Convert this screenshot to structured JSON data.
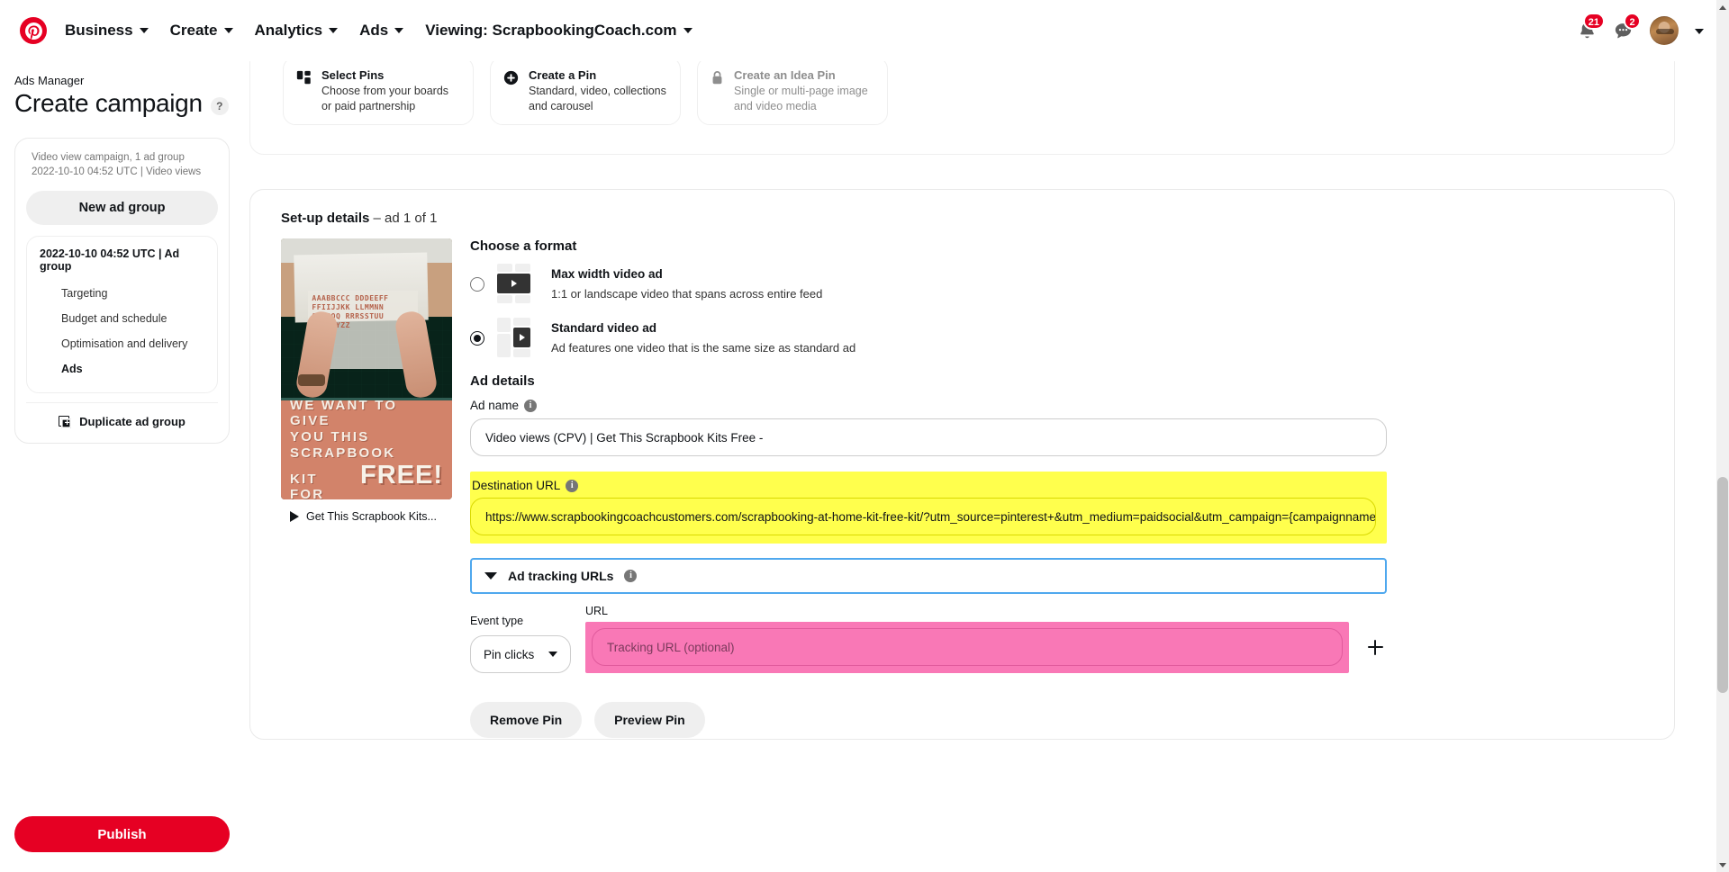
{
  "topnav": {
    "logo_icon": "pinterest-logo-icon",
    "items": [
      {
        "label": "Business",
        "icon": "chevron-down-icon"
      },
      {
        "label": "Create",
        "icon": "chevron-down-icon"
      },
      {
        "label": "Analytics",
        "icon": "chevron-down-icon"
      },
      {
        "label": "Ads",
        "icon": "chevron-down-icon"
      },
      {
        "label": "Viewing: ScrapbookingCoach.com",
        "icon": "chevron-down-icon"
      }
    ],
    "notifications_badge": "21",
    "messages_badge": "2",
    "notifications_icon": "bell-icon",
    "messages_icon": "chat-bubble-icon",
    "avatar_icon": "user-avatar",
    "account_chevron_icon": "chevron-down-icon"
  },
  "sidebar": {
    "eyebrow": "Ads Manager",
    "title": "Create campaign",
    "help_label": "?",
    "campaign_meta_line1": "Video view campaign, 1 ad group",
    "campaign_meta_line2": "2022-10-10 04:52 UTC | Video views",
    "new_ad_group_label": "New ad group",
    "ad_group_title": "2022-10-10 04:52 UTC | Ad group",
    "nav_items": [
      {
        "label": "Targeting",
        "active": false
      },
      {
        "label": "Budget and schedule",
        "active": false
      },
      {
        "label": "Optimisation and delivery",
        "active": false
      },
      {
        "label": "Ads",
        "active": true
      }
    ],
    "duplicate_label": "Duplicate ad group",
    "duplicate_icon": "duplicate-icon",
    "publish_label": "Publish",
    "publish_color": "#e60023"
  },
  "pin_source_cards": [
    {
      "title": "Select Pins",
      "desc_line1": "Choose from your boards",
      "desc_line2": "or paid partnership",
      "icon": "grid-pins-icon",
      "disabled": false
    },
    {
      "title": "Create a Pin",
      "desc_line1": "Standard, video, collections",
      "desc_line2": "and carousel",
      "icon": "plus-circle-icon",
      "disabled": false
    },
    {
      "title": "Create an Idea Pin",
      "desc_line1": "Single or multi-page image",
      "desc_line2": "and video media",
      "icon": "lock-icon",
      "disabled": true
    }
  ],
  "setup": {
    "heading_bold": "Set-up details",
    "heading_muted": " – ad 1 of 1",
    "preview": {
      "overlay_line1": "WE WANT TO GIVE",
      "overlay_line2": "YOU THIS SCRAPBOOK",
      "overlay_line3_kit": "KIT FOR",
      "overlay_line3_free": "FREE!",
      "sheet_text": "AAABBCCC DDDEEFF FFIIJJKK LLMMNN OOPPQQ RRRSSTUU VVWXYYZZ",
      "caption": "Get This Scrapbook Kits...",
      "play_icon": "play-icon"
    },
    "format": {
      "section_title": "Choose a format",
      "options": [
        {
          "title": "Max width video ad",
          "desc": "1:1 or landscape video that spans across entire feed",
          "selected": false,
          "thumb_icon": "max-width-video-thumb"
        },
        {
          "title": "Standard video ad",
          "desc": "Ad features one video that is the same size as standard ad",
          "selected": true,
          "thumb_icon": "standard-video-thumb"
        }
      ]
    },
    "ad_details": {
      "section_title": "Ad details",
      "ad_name_label": "Ad name",
      "ad_name_info_icon": "info-icon",
      "ad_name_value": "Video views (CPV) | Get This Scrapbook Kits Free -",
      "destination_url_label": "Destination URL",
      "destination_url_info_icon": "info-icon",
      "destination_url_value": "https://www.scrapbookingcoachcustomers.com/scrapbooking-at-home-kit-free-kit/?utm_source=pinterest+&utm_medium=paidsocial&utm_campaign={campaignname}...",
      "destination_highlight_color": "#ffff4d"
    },
    "tracking": {
      "header_label": "Ad tracking URLs",
      "header_info_icon": "info-icon",
      "header_chevron_icon": "chevron-down-icon",
      "header_focus_color": "#4fa8ee",
      "event_type_label": "Event type",
      "event_type_value": "Pin clicks",
      "event_type_chevron_icon": "chevron-down-icon",
      "url_label": "URL",
      "url_placeholder": "Tracking URL (optional)",
      "url_highlight_color": "#f978b6",
      "add_icon": "plus-icon"
    },
    "actions": {
      "remove_label": "Remove Pin",
      "preview_label": "Preview Pin"
    }
  },
  "scrollbar": {
    "up_icon": "scroll-up-arrow-icon",
    "down_icon": "scroll-down-arrow-icon",
    "thumb_icon": "scrollbar-thumb"
  }
}
